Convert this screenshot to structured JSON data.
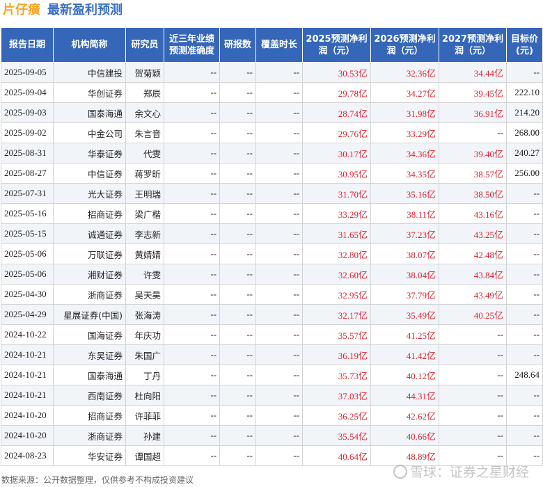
{
  "title": {
    "stock": "片仔癀",
    "section": "最新盈利预测"
  },
  "headers": [
    "报告日期",
    "机构简称",
    "研究员",
    "近三年业绩预测准确度",
    "研报数",
    "覆盖时长",
    "2025预测净利润（元）",
    "2026预测净利润（元）",
    "2027预测净利润（元）",
    "目标价(元)"
  ],
  "rows": [
    [
      "2025-09-05",
      "中信建投",
      "贺菊颖",
      "--",
      "--",
      "--",
      "30.53亿",
      "32.36亿",
      "34.44亿",
      "--"
    ],
    [
      "2025-09-04",
      "华创证券",
      "郑辰",
      "--",
      "--",
      "--",
      "29.78亿",
      "34.27亿",
      "39.45亿",
      "222.10"
    ],
    [
      "2025-09-03",
      "国泰海通",
      "余文心",
      "--",
      "--",
      "--",
      "28.74亿",
      "31.98亿",
      "36.91亿",
      "214.20"
    ],
    [
      "2025-09-02",
      "中金公司",
      "朱言音",
      "--",
      "--",
      "--",
      "29.76亿",
      "33.29亿",
      "--",
      "268.00"
    ],
    [
      "2025-08-31",
      "华泰证券",
      "代雯",
      "--",
      "--",
      "--",
      "30.17亿",
      "34.36亿",
      "39.40亿",
      "240.27"
    ],
    [
      "2025-08-27",
      "中信证券",
      "蒋罗昕",
      "--",
      "--",
      "--",
      "30.95亿",
      "34.35亿",
      "38.57亿",
      "256.00"
    ],
    [
      "2025-07-31",
      "光大证券",
      "王明瑞",
      "--",
      "--",
      "--",
      "31.70亿",
      "35.16亿",
      "38.50亿",
      "--"
    ],
    [
      "2025-05-16",
      "招商证券",
      "梁广楷",
      "--",
      "--",
      "--",
      "33.29亿",
      "38.11亿",
      "43.16亿",
      "--"
    ],
    [
      "2025-05-15",
      "诚通证券",
      "李志新",
      "--",
      "--",
      "--",
      "31.65亿",
      "37.23亿",
      "43.25亿",
      "--"
    ],
    [
      "2025-05-06",
      "万联证券",
      "黄婧婧",
      "--",
      "--",
      "--",
      "32.80亿",
      "38.07亿",
      "42.48亿",
      "--"
    ],
    [
      "2025-05-06",
      "湘财证券",
      "许雯",
      "--",
      "--",
      "--",
      "32.60亿",
      "38.04亿",
      "43.84亿",
      "--"
    ],
    [
      "2025-04-30",
      "浙商证券",
      "吴天昊",
      "--",
      "--",
      "--",
      "32.95亿",
      "37.79亿",
      "43.49亿",
      "--"
    ],
    [
      "2025-04-29",
      "星展证券(中国)",
      "张海涛",
      "--",
      "--",
      "--",
      "32.17亿",
      "35.49亿",
      "40.25亿",
      "--"
    ],
    [
      "2024-10-22",
      "国海证券",
      "年庆功",
      "--",
      "--",
      "--",
      "35.57亿",
      "41.25亿",
      "--",
      "--"
    ],
    [
      "2024-10-21",
      "东吴证券",
      "朱国广",
      "--",
      "--",
      "--",
      "36.19亿",
      "41.42亿",
      "--",
      "--"
    ],
    [
      "2024-10-21",
      "国泰海通",
      "丁丹",
      "--",
      "--",
      "--",
      "35.73亿",
      "40.12亿",
      "--",
      "248.64"
    ],
    [
      "2024-10-21",
      "西南证券",
      "杜向阳",
      "--",
      "--",
      "--",
      "37.03亿",
      "44.31亿",
      "--",
      "--"
    ],
    [
      "2024-10-20",
      "招商证券",
      "许菲菲",
      "--",
      "--",
      "--",
      "36.25亿",
      "42.62亿",
      "--",
      "--"
    ],
    [
      "2024-10-20",
      "浙商证券",
      "孙建",
      "--",
      "--",
      "--",
      "35.54亿",
      "40.66亿",
      "--",
      "--"
    ],
    [
      "2024-08-23",
      "华安证券",
      "谭国超",
      "--",
      "--",
      "--",
      "40.64亿",
      "48.89亿",
      "--",
      "--"
    ]
  ],
  "footer": "数据来源：公开数据整理，仅供参考不构成投资建议",
  "watermark": "雪球：证券之星财经",
  "colors": {
    "header_bg": "#3566b8",
    "forecast_red": "#e0262d",
    "title_orange": "#f5a623",
    "title_blue": "#3a6fc4"
  }
}
